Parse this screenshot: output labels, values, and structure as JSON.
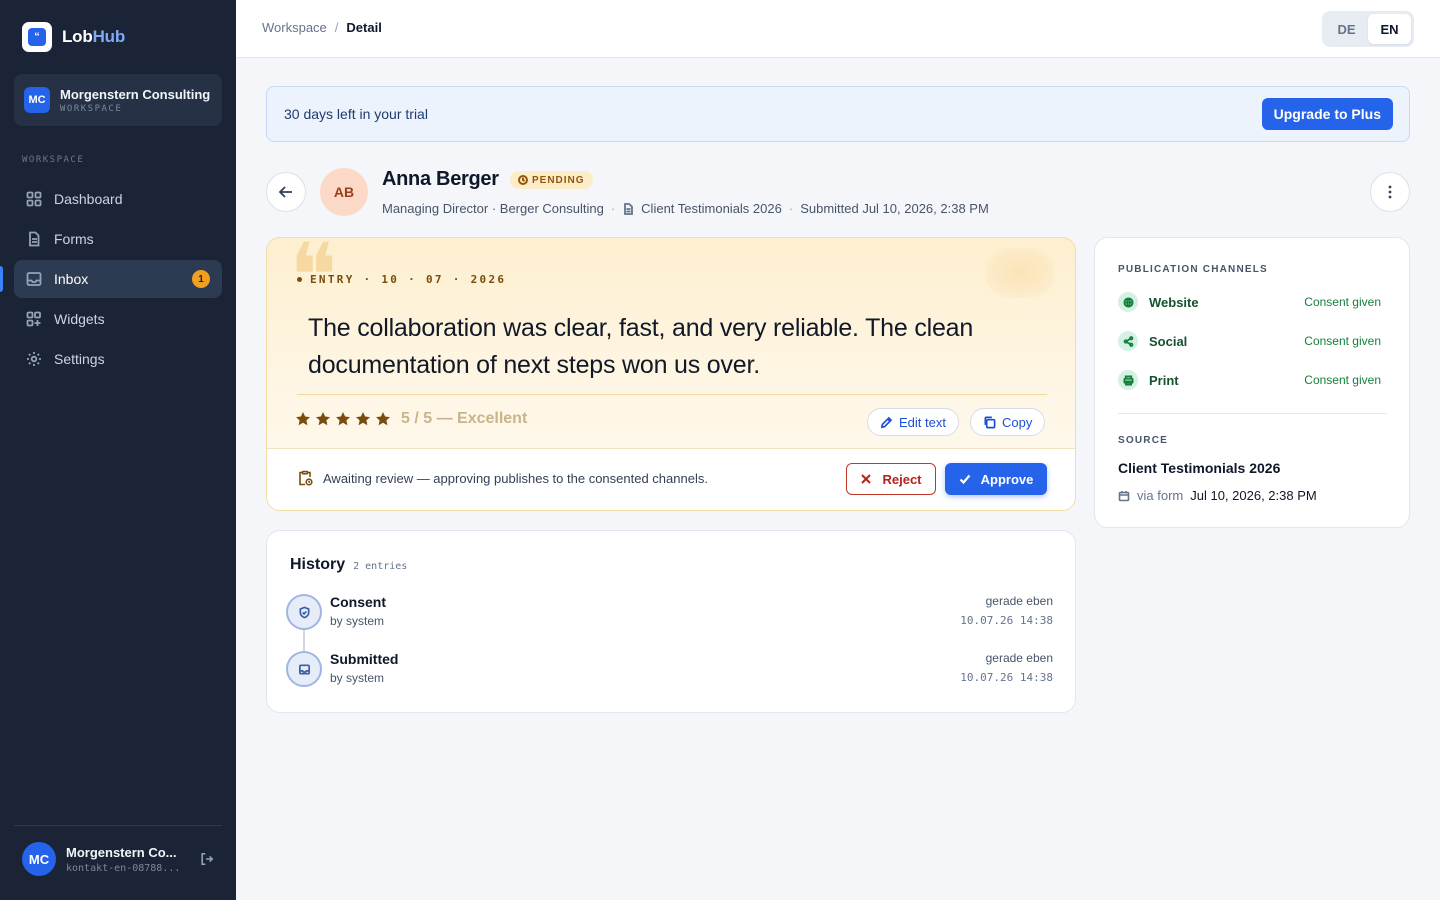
{
  "brand": {
    "name_a": "Lob",
    "name_b": "Hub",
    "logo_glyph": "“"
  },
  "workspace_card": {
    "initials": "MC",
    "name": "Morgenstern Consulting",
    "sub": "WORKSPACE"
  },
  "nav": {
    "section_label": "WORKSPACE",
    "items": [
      {
        "label": "Dashboard",
        "icon": "grid-icon"
      },
      {
        "label": "Forms",
        "icon": "document-icon"
      },
      {
        "label": "Inbox",
        "icon": "inbox-icon",
        "badge": "1",
        "active": true
      },
      {
        "label": "Widgets",
        "icon": "widgets-icon"
      },
      {
        "label": "Settings",
        "icon": "gear-icon"
      }
    ]
  },
  "user": {
    "initials": "MC",
    "name": "Morgenstern Co...",
    "email": "kontakt-en-08788..."
  },
  "breadcrumb": {
    "root": "Workspace",
    "sep": "/",
    "current": "Detail"
  },
  "lang": {
    "de": "DE",
    "en": "EN",
    "selected": "EN"
  },
  "trial": {
    "text": "30 days left in your trial",
    "button": "Upgrade to Plus"
  },
  "submission": {
    "initials": "AB",
    "name": "Anna Berger",
    "status": "PENDING",
    "role": "Managing Director · Berger Consulting",
    "form": "Client Testimonials 2026",
    "submitted": "Submitted Jul 10, 2026, 2:38 PM",
    "dot": "·"
  },
  "testimonial": {
    "entry_label": "ENTRY · 10 · 07 · 2026",
    "quote_mark": "❝",
    "text": "The collaboration was clear, fast, and very reliable. The clean documentation of next steps won us over.",
    "rating": 5,
    "rating_text": "5 / 5 — Excellent",
    "edit_label": "Edit text",
    "copy_label": "Copy",
    "review_text": "Awaiting review — approving publishes to the consented channels.",
    "reject_label": "Reject",
    "approve_label": "Approve"
  },
  "channels": {
    "label": "PUBLICATION CHANNELS",
    "items": [
      {
        "name": "Website",
        "status": "Consent given",
        "icon": "globe-icon"
      },
      {
        "name": "Social",
        "status": "Consent given",
        "icon": "share-icon"
      },
      {
        "name": "Print",
        "status": "Consent given",
        "icon": "printer-icon"
      }
    ]
  },
  "source": {
    "label": "SOURCE",
    "title": "Client Testimonials 2026",
    "via": "via form",
    "date": "Jul 10, 2026, 2:38 PM"
  },
  "history": {
    "title": "History",
    "count": "2 entries",
    "items": [
      {
        "name": "Consent",
        "by": "by system",
        "relative": "gerade eben",
        "timestamp": "10.07.26 14:38",
        "icon": "shield-icon"
      },
      {
        "name": "Submitted",
        "by": "by system",
        "relative": "gerade eben",
        "timestamp": "10.07.26 14:38",
        "icon": "inbox-icon"
      }
    ]
  },
  "colors": {
    "accent": "#2563eb",
    "sidebar": "#1b2436",
    "pending": "#92580a",
    "consent": "#15803d",
    "reject": "#b42318"
  }
}
